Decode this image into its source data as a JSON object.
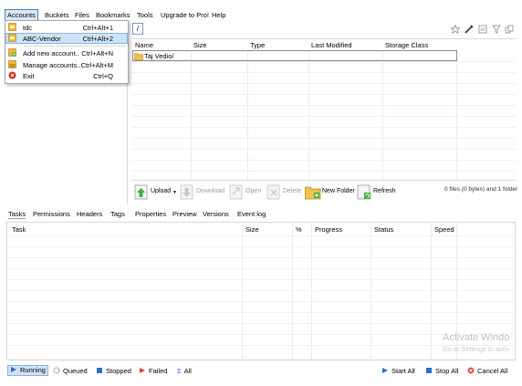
{
  "menubar": {
    "items": [
      "Accounts",
      "Buckets",
      "Files",
      "Bookmarks",
      "Tools",
      "Upgrade to Pro!",
      "Help"
    ]
  },
  "accounts_menu": {
    "items": [
      {
        "label": "tdc",
        "shortcut": "Ctrl+Alt+1"
      },
      {
        "label": "ABC-Vendor",
        "shortcut": "Ctrl+Alt+2",
        "selected": true
      },
      {
        "label": "Add new account..",
        "shortcut": "Ctrl+Alt+N"
      },
      {
        "label": "Manage accounts..",
        "shortcut": "Ctrl+Alt+M"
      },
      {
        "label": "Exit",
        "shortcut": "Ctrl+Q"
      }
    ]
  },
  "path": {
    "value": "/"
  },
  "file_table": {
    "columns": [
      "Name",
      "Size",
      "Type",
      "Last Modified",
      "Storage Class"
    ],
    "rows": [
      {
        "name": "Taj Vedio/"
      }
    ]
  },
  "actions": {
    "upload": "Upload",
    "download": "Download",
    "open": "Open",
    "delete": "Delete",
    "new_folder": "New Folder",
    "refresh": "Refresh",
    "summary": "0 files (0 bytes) and 1 folder"
  },
  "tabs": [
    "Tasks",
    "Permissions",
    "Headers",
    "Tags",
    "Properties",
    "Preview",
    "Versions",
    "Event log"
  ],
  "transfer_table": {
    "columns": [
      "Task",
      "Size",
      "%",
      "Progress",
      "Status",
      "Speed"
    ]
  },
  "watermark": {
    "line1": "Activate Windo",
    "line2": "Go to Settings to activ"
  },
  "statusbar": {
    "running": "Running",
    "queued": "Queued",
    "stopped": "Stopped",
    "failed": "Failed",
    "all": "All",
    "start_all": "Start All",
    "stop_all": "Stop All",
    "cancel_all": "Cancel All"
  },
  "colors": {
    "accent": "#4a7dbf",
    "selection": "#cce3f8",
    "folder": "#f0c24a"
  }
}
